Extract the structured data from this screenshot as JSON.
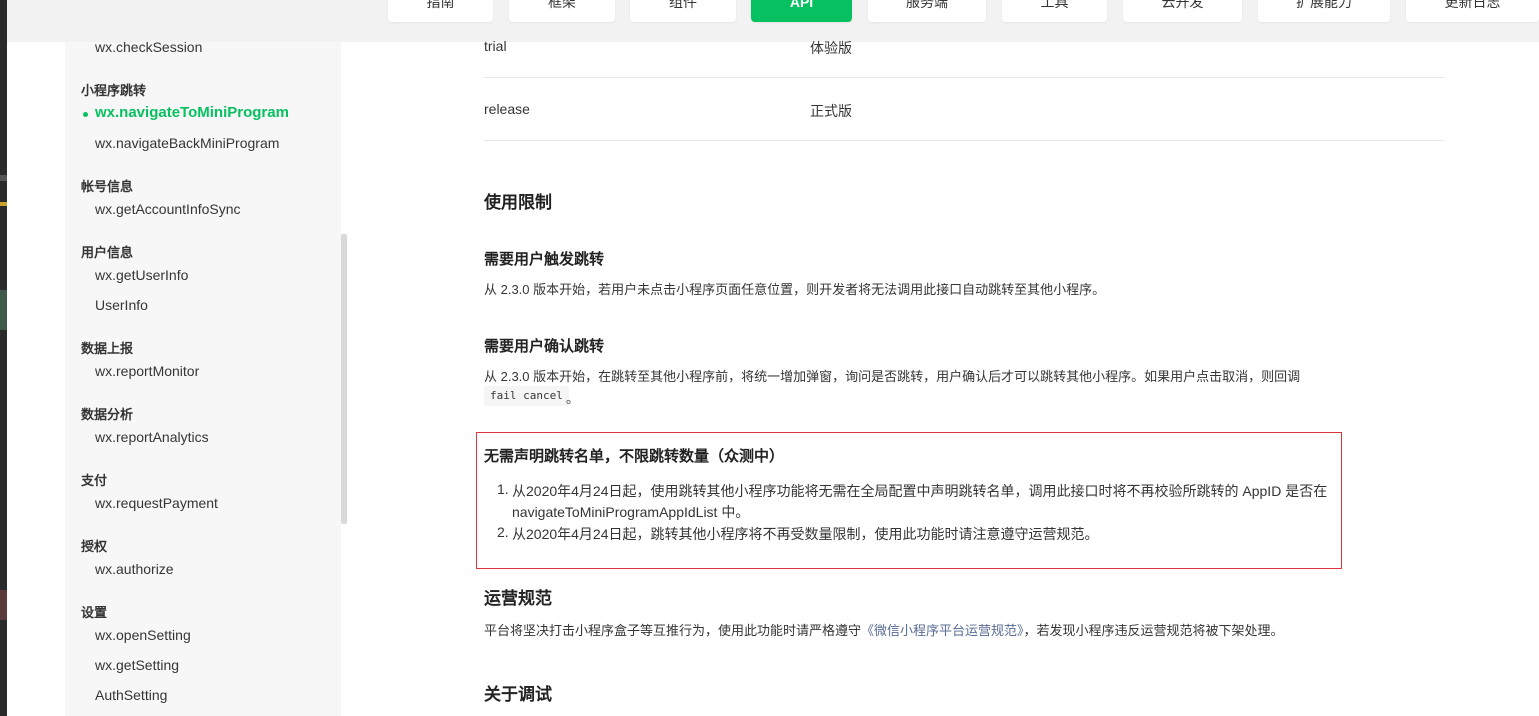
{
  "nav": {
    "tabs": [
      {
        "label": "指南",
        "active": false
      },
      {
        "label": "框架",
        "active": false
      },
      {
        "label": "组件",
        "active": false
      },
      {
        "label": "API",
        "active": true
      },
      {
        "label": "服务端",
        "active": false
      },
      {
        "label": "工具",
        "active": false
      },
      {
        "label": "云开发",
        "active": false
      },
      {
        "label": "扩展能力",
        "active": false
      },
      {
        "label": "更新日志",
        "active": false
      }
    ]
  },
  "sidebar": {
    "item_checksession": "wx.checkSession",
    "group_jump": "小程序跳转",
    "item_navigate_to": "wx.navigateToMiniProgram",
    "item_navigate_back": "wx.navigateBackMiniProgram",
    "group_account": "帐号信息",
    "item_account_info": "wx.getAccountInfoSync",
    "group_userinfo": "用户信息",
    "item_get_userinfo": "wx.getUserInfo",
    "item_userinfo": "UserInfo",
    "group_report": "数据上报",
    "item_report_monitor": "wx.reportMonitor",
    "group_analysis": "数据分析",
    "item_report_analytics": "wx.reportAnalytics",
    "group_payment": "支付",
    "item_request_payment": "wx.requestPayment",
    "group_auth": "授权",
    "item_authorize": "wx.authorize",
    "group_settings": "设置",
    "item_open_setting": "wx.openSetting",
    "item_get_setting": "wx.getSetting",
    "item_auth_setting": "AuthSetting"
  },
  "table": {
    "rows": [
      {
        "value": "trial",
        "desc": "体验版"
      },
      {
        "value": "release",
        "desc": "正式版"
      }
    ]
  },
  "content": {
    "limits_heading": "使用限制",
    "trigger_heading": "需要用户触发跳转",
    "trigger_text": "从 2.3.0 版本开始，若用户未点击小程序页面任意位置，则开发者将无法调用此接口自动跳转至其他小程序。",
    "confirm_heading": "需要用户确认跳转",
    "confirm_text": "从 2.3.0 版本开始，在跳转至其他小程序前，将统一增加弹窗，询问是否跳转，用户确认后才可以跳转其他小程序。如果用户点击取消，则回调",
    "confirm_code": "fail cancel",
    "confirm_period": "。",
    "nolist_heading": "无需声明跳转名单，不限跳转数量（众测中）",
    "nolist_item1_num": "1.",
    "nolist_item1_line1": "从2020年4月24日起，使用跳转其他小程序功能将无需在全局配置中声明跳转名单，调用此接口时将不再校验所跳转的 AppID 是否在",
    "nolist_item1_line2": "navigateToMiniProgramAppIdList 中。",
    "nolist_item2_num": "2.",
    "nolist_item2": "从2020年4月24日起，跳转其他小程序将不再受数量限制，使用此功能时请注意遵守运营规范。",
    "ops_heading": "运营规范",
    "ops_text_before": "平台将坚决打击小程序盒子等互推行为，使用此功能时请严格遵守",
    "ops_link": "《微信小程序平台运营规范》",
    "ops_text_after": "，若发现小程序违反运营规范将被下架处理。",
    "debug_heading": "关于调试"
  },
  "colors": {
    "accent": "#07c160",
    "link": "#576b95",
    "highlight_border": "#d9363e"
  }
}
